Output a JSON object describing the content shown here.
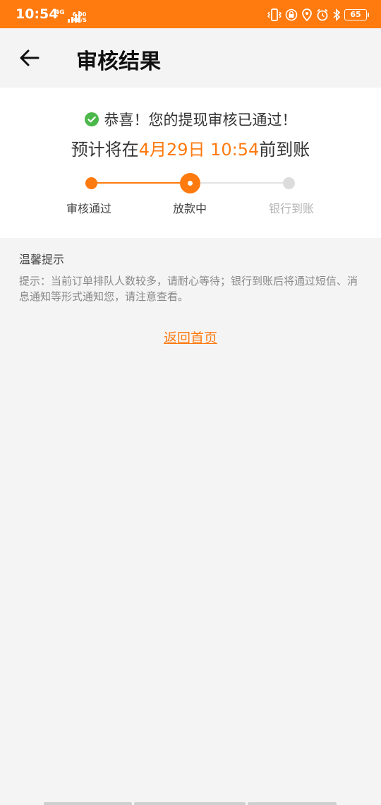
{
  "status_bar": {
    "time": "10:54",
    "network_tag": "4G",
    "speed_value": "6.00",
    "speed_unit": "KB/S",
    "battery": "65",
    "colors": {
      "background": "#ff7a0f",
      "foreground": "#ffffff"
    },
    "icons": [
      "vibrate-icon",
      "lock-rotation-icon",
      "location-icon",
      "alarm-icon",
      "bluetooth-icon",
      "battery-icon"
    ]
  },
  "header": {
    "title": "审核结果",
    "back_icon": "arrow-left-icon"
  },
  "result": {
    "icon": "check-circle-icon",
    "congrats": "恭喜！您的提现审核已通过！",
    "eta_prefix": "预计将在",
    "eta_time": "4月29日 10:54",
    "eta_suffix": "前到账",
    "accent_color": "#ff7a0f",
    "success_color": "#4cb84c"
  },
  "progress": {
    "current_step": 2,
    "steps": [
      {
        "label": "审核通过",
        "state": "done"
      },
      {
        "label": "放款中",
        "state": "current"
      },
      {
        "label": "银行到账",
        "state": "pending"
      }
    ]
  },
  "tips": {
    "title": "温馨提示",
    "body": "提示：当前订单排队人数较多，请耐心等待；银行到账后将通过短信、消息通知等形式通知您，请注意查看。"
  },
  "actions": {
    "home_link": "返回首页"
  }
}
